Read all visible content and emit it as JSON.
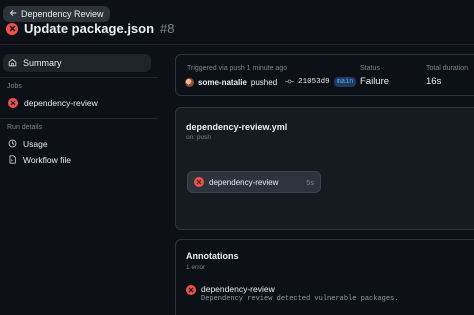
{
  "header": {
    "back_label": "Dependency Review",
    "title": "Update package.json",
    "run_number": "#8"
  },
  "sidebar": {
    "summary_label": "Summary",
    "jobs_heading": "Jobs",
    "jobs": [
      {
        "label": "dependency-review",
        "status": "failure"
      }
    ],
    "run_details_heading": "Run details",
    "run_details": [
      {
        "label": "Usage",
        "icon": "clock-icon"
      },
      {
        "label": "Workflow file",
        "icon": "file-icon"
      }
    ]
  },
  "summary": {
    "triggered_label": "Triggered via push 1 minute ago",
    "actor": "some-natalie",
    "action": "pushed",
    "commit": "21053d9",
    "branch": "main",
    "status_label": "Status",
    "status_value": "Failure",
    "duration_label": "Total duration",
    "duration_value": "16s"
  },
  "workflow": {
    "file": "dependency-review.yml",
    "trigger": "on: push",
    "job_name": "dependency-review",
    "job_duration": "5s"
  },
  "annotations": {
    "title": "Annotations",
    "count": "1 error",
    "items": [
      {
        "title": "dependency-review",
        "message": "Dependency review detected vulnerable packages."
      }
    ]
  },
  "colors": {
    "background": "#0d1117",
    "failure": "#f85149",
    "link": "#58a6ff",
    "muted": "#7d8590"
  }
}
